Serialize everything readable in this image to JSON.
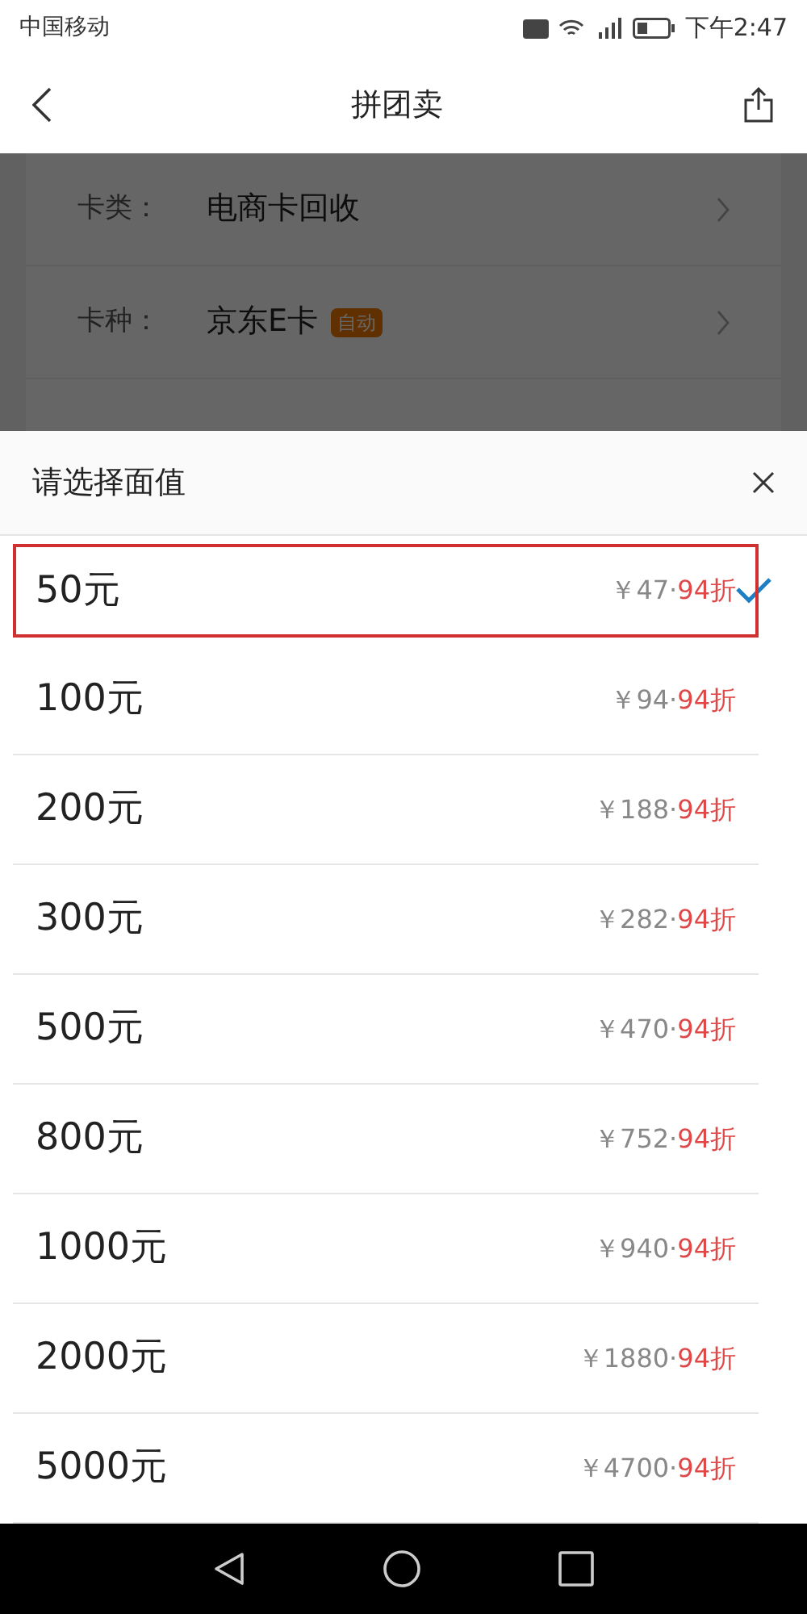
{
  "status_bar": {
    "carrier": "中国移动",
    "time": "下午2:47"
  },
  "header": {
    "title": "拼团卖"
  },
  "form": [
    {
      "label": "卡类：",
      "value": "电商卡回收"
    },
    {
      "label": "卡种：",
      "value": "京东E卡",
      "badge": "自动"
    }
  ],
  "sheet": {
    "title": "请选择面值",
    "options": [
      {
        "amount": "50元",
        "price": "￥47·",
        "discount": "94折",
        "selected": true
      },
      {
        "amount": "100元",
        "price": "￥94·",
        "discount": "94折",
        "selected": false
      },
      {
        "amount": "200元",
        "price": "￥188·",
        "discount": "94折",
        "selected": false
      },
      {
        "amount": "300元",
        "price": "￥282·",
        "discount": "94折",
        "selected": false
      },
      {
        "amount": "500元",
        "price": "￥470·",
        "discount": "94折",
        "selected": false
      },
      {
        "amount": "800元",
        "price": "￥752·",
        "discount": "94折",
        "selected": false
      },
      {
        "amount": "1000元",
        "price": "￥940·",
        "discount": "94折",
        "selected": false
      },
      {
        "amount": "2000元",
        "price": "￥1880·",
        "discount": "94折",
        "selected": false
      },
      {
        "amount": "5000元",
        "price": "￥4700·",
        "discount": "94折",
        "selected": false
      }
    ]
  }
}
